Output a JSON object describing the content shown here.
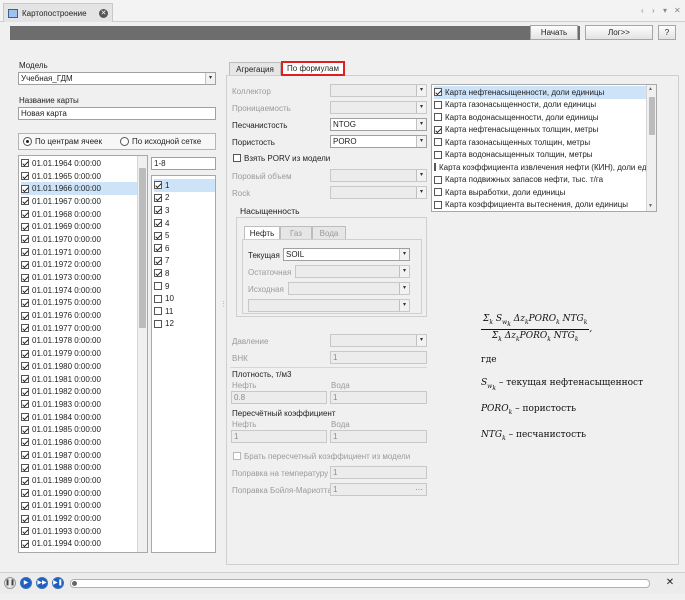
{
  "window": {
    "tab_title": "Картопостроение",
    "controls": [
      "‹",
      "›",
      "▾",
      "✕"
    ]
  },
  "toolbar": {
    "start_label": "Начать",
    "log_label": "Лог>>",
    "help_label": "?"
  },
  "left": {
    "model_label": "Модель",
    "model_value": "Учебная_ГДМ",
    "map_name_label": "Название карты",
    "map_name_value": "Новая карта",
    "radio_cells": "По центрам ячеек",
    "radio_grid": "По исходной сетке",
    "dates": [
      {
        "label": "01.01.1964 0:00:00",
        "checked": true,
        "selected": false
      },
      {
        "label": "01.01.1965 0:00:00",
        "checked": true,
        "selected": false
      },
      {
        "label": "01.01.1966 0:00:00",
        "checked": true,
        "selected": true
      },
      {
        "label": "01.01.1967 0:00:00",
        "checked": true,
        "selected": false
      },
      {
        "label": "01.01.1968 0:00:00",
        "checked": true,
        "selected": false
      },
      {
        "label": "01.01.1969 0:00:00",
        "checked": true,
        "selected": false
      },
      {
        "label": "01.01.1970 0:00:00",
        "checked": true,
        "selected": false
      },
      {
        "label": "01.01.1971 0:00:00",
        "checked": true,
        "selected": false
      },
      {
        "label": "01.01.1972 0:00:00",
        "checked": true,
        "selected": false
      },
      {
        "label": "01.01.1973 0:00:00",
        "checked": true,
        "selected": false
      },
      {
        "label": "01.01.1974 0:00:00",
        "checked": true,
        "selected": false
      },
      {
        "label": "01.01.1975 0:00:00",
        "checked": true,
        "selected": false
      },
      {
        "label": "01.01.1976 0:00:00",
        "checked": true,
        "selected": false
      },
      {
        "label": "01.01.1977 0:00:00",
        "checked": true,
        "selected": false
      },
      {
        "label": "01.01.1978 0:00:00",
        "checked": true,
        "selected": false
      },
      {
        "label": "01.01.1979 0:00:00",
        "checked": true,
        "selected": false
      },
      {
        "label": "01.01.1980 0:00:00",
        "checked": true,
        "selected": false
      },
      {
        "label": "01.01.1981 0:00:00",
        "checked": true,
        "selected": false
      },
      {
        "label": "01.01.1982 0:00:00",
        "checked": true,
        "selected": false
      },
      {
        "label": "01.01.1983 0:00:00",
        "checked": true,
        "selected": false
      },
      {
        "label": "01.01.1984 0:00:00",
        "checked": true,
        "selected": false
      },
      {
        "label": "01.01.1985 0:00:00",
        "checked": true,
        "selected": false
      },
      {
        "label": "01.01.1986 0:00:00",
        "checked": true,
        "selected": false
      },
      {
        "label": "01.01.1987 0:00:00",
        "checked": true,
        "selected": false
      },
      {
        "label": "01.01.1988 0:00:00",
        "checked": true,
        "selected": false
      },
      {
        "label": "01.01.1989 0:00:00",
        "checked": true,
        "selected": false
      },
      {
        "label": "01.01.1990 0:00:00",
        "checked": true,
        "selected": false
      },
      {
        "label": "01.01.1991 0:00:00",
        "checked": true,
        "selected": false
      },
      {
        "label": "01.01.1992 0:00:00",
        "checked": true,
        "selected": false
      },
      {
        "label": "01.01.1993 0:00:00",
        "checked": true,
        "selected": false
      },
      {
        "label": "01.01.1994 0:00:00",
        "checked": true,
        "selected": false
      }
    ],
    "layers_range": "1-8",
    "layers": [
      {
        "label": "1",
        "checked": true,
        "selected": true
      },
      {
        "label": "2",
        "checked": true,
        "selected": false
      },
      {
        "label": "3",
        "checked": true,
        "selected": false
      },
      {
        "label": "4",
        "checked": true,
        "selected": false
      },
      {
        "label": "5",
        "checked": true,
        "selected": false
      },
      {
        "label": "6",
        "checked": true,
        "selected": false
      },
      {
        "label": "7",
        "checked": true,
        "selected": false
      },
      {
        "label": "8",
        "checked": true,
        "selected": false
      },
      {
        "label": "9",
        "checked": false,
        "selected": false
      },
      {
        "label": "10",
        "checked": false,
        "selected": false
      },
      {
        "label": "11",
        "checked": false,
        "selected": false
      },
      {
        "label": "12",
        "checked": false,
        "selected": false
      }
    ]
  },
  "tabs": {
    "aggregation": "Агрегация",
    "by_formulas": "По формулам"
  },
  "form": {
    "collector": "Коллектор",
    "permeability": "Проницаемость",
    "net_to_gross": "Песчанистость",
    "net_to_gross_value": "NTOG",
    "porosity": "Пористость",
    "porosity_value": "PORO",
    "take_porv": "Взять PORV из модели",
    "pore_volume": "Поровый объем",
    "rock": "Rock",
    "saturation_group": "Насыщенность",
    "sat_tabs": [
      "Нефть",
      "Газ",
      "Вода"
    ],
    "current": "Текущая",
    "current_value": "SOIL",
    "residual": "Остаточная",
    "initial": "Исходная",
    "pressure": "Давление",
    "wok": "ВНК",
    "wok_value": "1",
    "density": "Плотность, т/м3",
    "oil": "Нефть",
    "water": "Вода",
    "density_oil": "0.8",
    "density_water": "1",
    "conv_factor": "Пересчётный  коэффициент",
    "conv_oil": "1",
    "conv_water": "1",
    "take_conv": "Брать пересчетный коэффициент из модели",
    "temp_corr": "Поправка на температуру",
    "temp_corr_value": "1",
    "boyle_corr": "Поправка Бойля-Мариотта",
    "boyle_corr_value": "1"
  },
  "map_types": [
    {
      "label": "Карта нефтенасыщенности, доли единицы",
      "checked": true,
      "selected": true
    },
    {
      "label": "Карта газонасыщенности, доли единицы",
      "checked": false,
      "selected": false
    },
    {
      "label": "Карта водонасыщенности, доли единицы",
      "checked": false,
      "selected": false
    },
    {
      "label": "Карта нефтенасыщенных толщин, метры",
      "checked": true,
      "selected": false
    },
    {
      "label": "Карта газонасыщенных толщин, метры",
      "checked": false,
      "selected": false
    },
    {
      "label": "Карта водонасыщенных толщин, метры",
      "checked": false,
      "selected": false
    },
    {
      "label": "Карта коэффициента извлечения нефти (КИН), доли ед",
      "checked": false,
      "selected": false
    },
    {
      "label": "Карта подвижных запасов нефти, тыс. т/га",
      "checked": false,
      "selected": false
    },
    {
      "label": "Карта выработки, доли единицы",
      "checked": false,
      "selected": false
    },
    {
      "label": "Карта коэффициента вытеснения, доли единицы",
      "checked": false,
      "selected": false
    }
  ],
  "formula": {
    "where": "где",
    "s_desc": "–  текущая нефтенасыщенност",
    "poro_desc": "– пористость",
    "ntg_desc": "– песчанистость"
  },
  "colors": {
    "toolbar": "#6d6d6d",
    "highlight": "#e02020",
    "selection": "#cde3f7",
    "play": "#1f5fc4"
  }
}
